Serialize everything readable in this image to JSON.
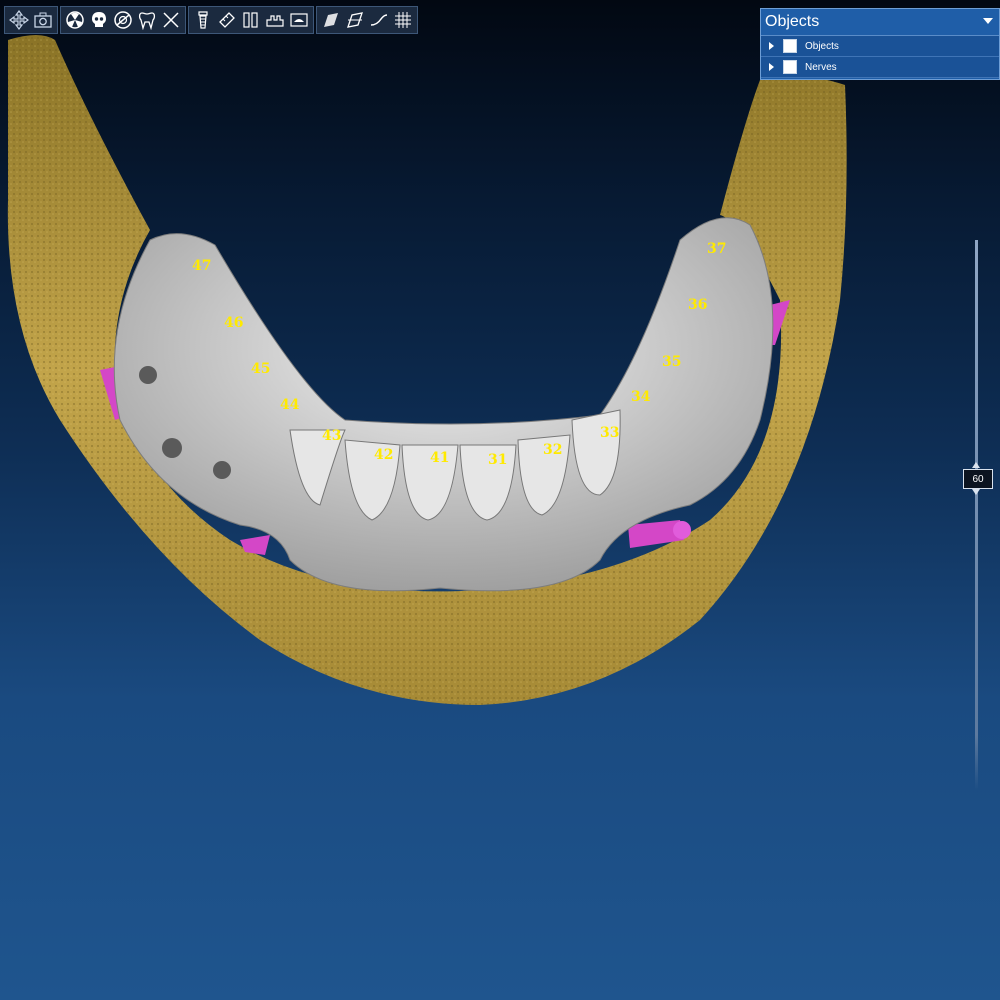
{
  "toolbar": {
    "groups": [
      {
        "tools": [
          "move-icon",
          "camera-icon"
        ]
      },
      {
        "tools": [
          "radiation-icon",
          "skull-icon",
          "no-view-icon",
          "tooth-icon",
          "cross-icon"
        ]
      },
      {
        "tools": [
          "implant-icon",
          "ruler-icon",
          "abutment-icon",
          "bone-icon",
          "scan-icon"
        ]
      },
      {
        "tools": [
          "plane-icon",
          "cut-plane-icon",
          "curve-icon",
          "grid-icon"
        ]
      }
    ]
  },
  "objects_panel": {
    "title": "Objects",
    "rows": [
      {
        "label": "Objects",
        "checked": false
      },
      {
        "label": "Nerves",
        "checked": false
      }
    ]
  },
  "slider": {
    "value": "60"
  },
  "teeth": [
    {
      "number": "47"
    },
    {
      "number": "46"
    },
    {
      "number": "45"
    },
    {
      "number": "44"
    },
    {
      "number": "43"
    },
    {
      "number": "42"
    },
    {
      "number": "41"
    },
    {
      "number": "31"
    },
    {
      "number": "32"
    },
    {
      "number": "33"
    },
    {
      "number": "34"
    },
    {
      "number": "35"
    },
    {
      "number": "36"
    },
    {
      "number": "37"
    }
  ],
  "colors": {
    "bone": "#b59a3e",
    "teeth": "#d6d6d6",
    "nerve": "#d447c7",
    "label": "#ffea00",
    "panel": "#1f5ea8"
  }
}
